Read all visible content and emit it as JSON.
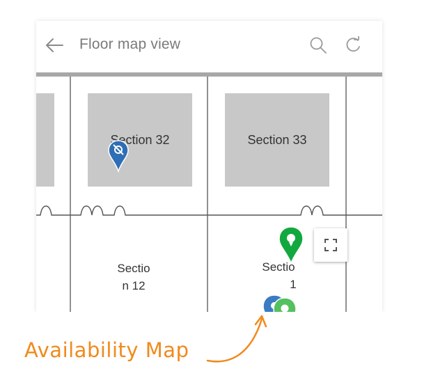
{
  "appbar": {
    "title": "Floor map view",
    "back_icon": "arrow-left-icon",
    "search_icon": "search-icon",
    "refresh_icon": "refresh-icon"
  },
  "map": {
    "sections": [
      {
        "label": "Section 32"
      },
      {
        "label": "Section 33"
      },
      {
        "label_line1": "Sectio",
        "label_line2": "n 12"
      },
      {
        "label_line1": "Sectio",
        "label_line2": "1"
      }
    ],
    "pins": [
      {
        "icon": "map-pin-icon",
        "color": "#2e6eb5",
        "status": "unavailable"
      },
      {
        "icon": "map-pin-icon",
        "color": "#13a83f",
        "status": "available"
      },
      {
        "icon": "map-pin-icon",
        "color": "#3c7bc2",
        "status": "cluster"
      },
      {
        "icon": "map-pin-icon",
        "color": "#55c05f",
        "status": "available"
      }
    ],
    "expand_icon": "fullscreen-icon"
  },
  "annotation": {
    "label": "Availability Map",
    "color": "#f08a1c"
  }
}
